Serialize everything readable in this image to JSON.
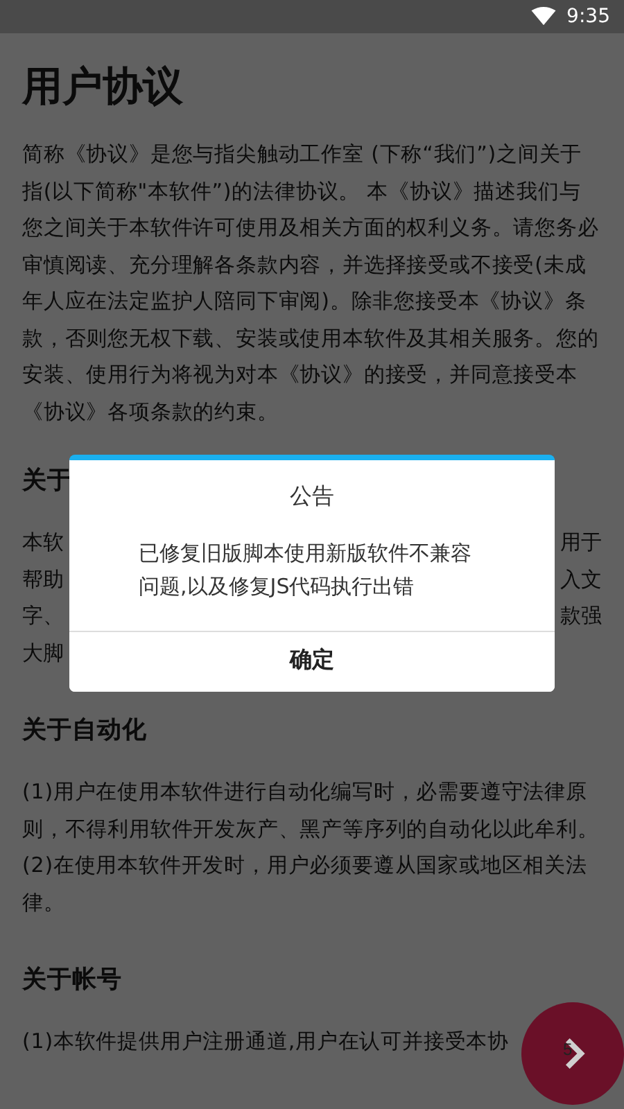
{
  "status_bar": {
    "time": "9:35"
  },
  "title": "用户协议",
  "sections": [
    {
      "kind": "paragraph",
      "text": "简称《协议》是您与指尖触动工作室 (下称“我们”)之间关于指(以下简称\"本软件”)的法律协议。 本《协议》描述我们与您之间关于本软件许可使用及相关方面的权利义务。请您务必审慎阅读、充分理解各条款内容，并选择接受或不接受(未成年人应在法定监护人陪同下审阅)。除非您接受本《协议》条款，否则您无权下载、安装或使用本软件及其相关服务。您的安装、使用行为将视为对本《协议》的接受，并同意接受本《协议》各项条款的约束。"
    },
    {
      "kind": "partial",
      "heading": "关于",
      "lines": [
        {
          "left": "本软",
          "right": "用于"
        },
        {
          "left": "帮助",
          "right": "入文"
        },
        {
          "left": "字、",
          "right": "款强"
        },
        {
          "left": "大脚"
        }
      ]
    },
    {
      "kind": "section",
      "heading": "关于自动化",
      "paragraphs": [
        "(1)用户在使用本软件进行自动化编写时，必需要遵守法律原则，不得利用软件开发灰产、黑产等序列的自动化以此牟利。",
        "(2)在使用本软件开发时，用户必须要遵从国家或地区相关法律。"
      ]
    },
    {
      "kind": "section",
      "heading": "关于帐号",
      "paragraphs": [
        "(1)本软件提供用户注册通道,用户在认可并接受本协"
      ]
    }
  ],
  "dialog": {
    "title": "公告",
    "message": "已修复旧版脚本使用新版软件不兼容问题,以及修复JS代码执行出错",
    "button": "确定"
  },
  "fab": {
    "badge": "5"
  }
}
